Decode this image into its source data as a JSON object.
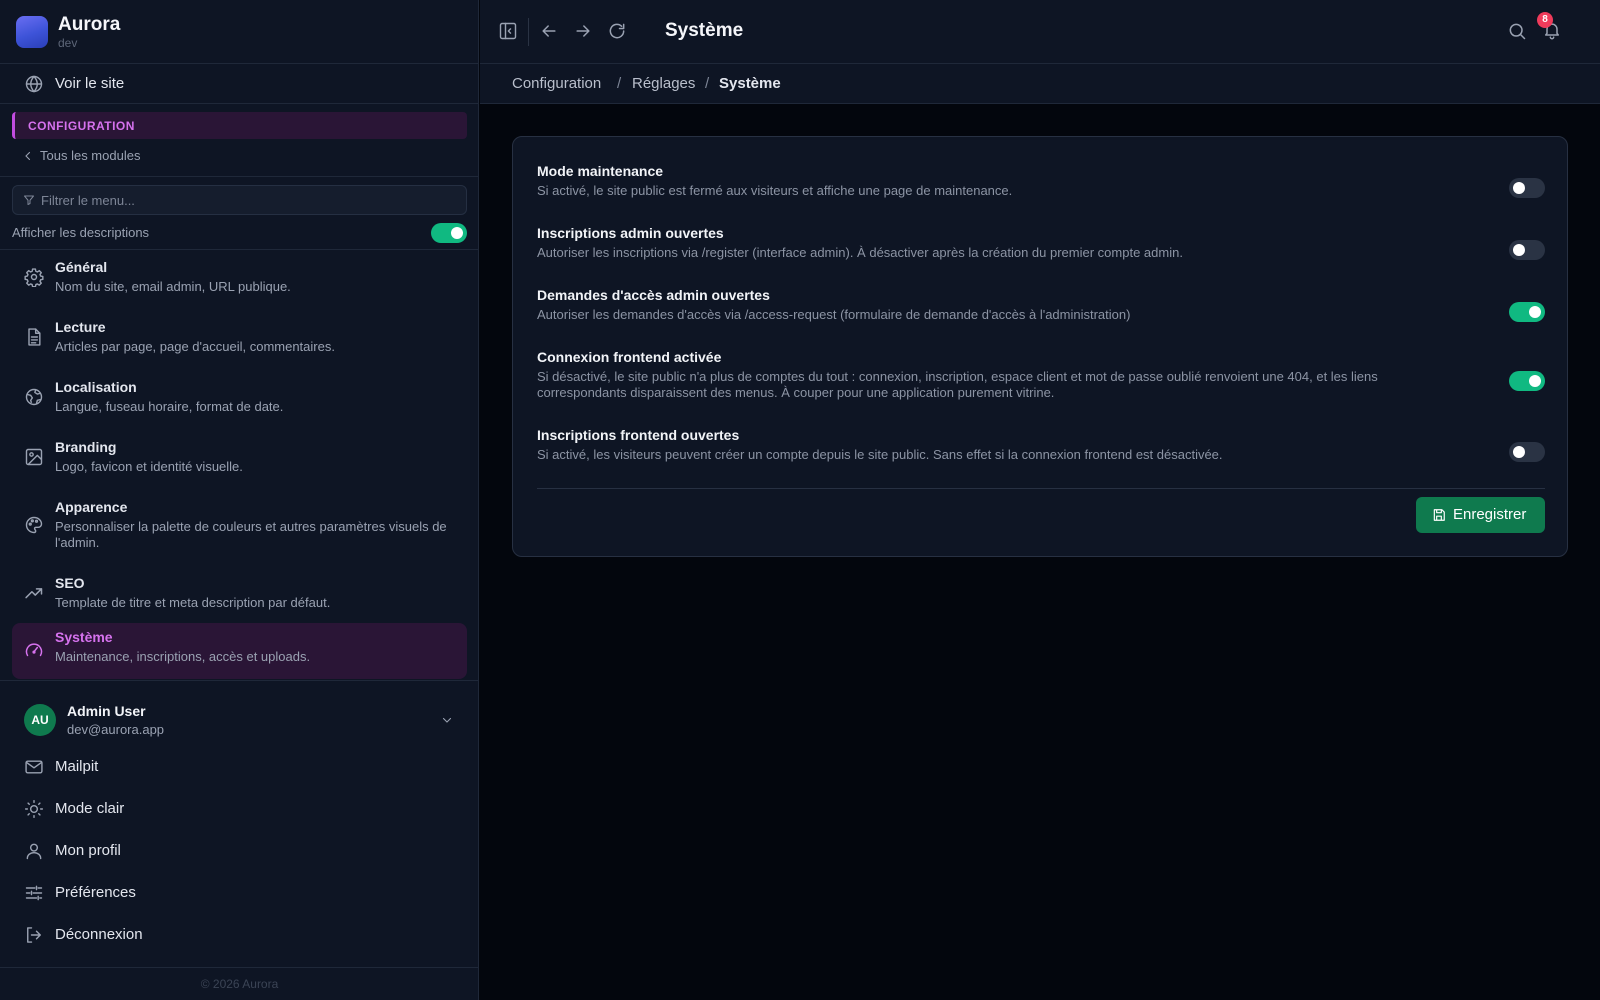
{
  "app": {
    "name": "Aurora",
    "env": "dev"
  },
  "colors": {
    "accent": "#d672ee",
    "active_bg": "#2a1536",
    "toggle_on": "#10b981",
    "primary_button": "#0f7a4e",
    "badge": "#ef3b5b"
  },
  "sidebar": {
    "view_site": {
      "label": "Voir le site",
      "icon": "globe-icon"
    },
    "section_label": "CONFIGURATION",
    "back_label": "Tous les modules",
    "filter": {
      "placeholder": "Filtrer le menu...",
      "value": ""
    },
    "show_descriptions": {
      "label": "Afficher les descriptions",
      "enabled": true
    },
    "items": [
      {
        "title": "Général",
        "desc": "Nom du site, email admin, URL publique.",
        "icon": "gear-icon",
        "active": false
      },
      {
        "title": "Lecture",
        "desc": "Articles par page, page d'accueil, commentaires.",
        "icon": "document-icon",
        "active": false
      },
      {
        "title": "Localisation",
        "desc": "Langue, fuseau horaire, format de date.",
        "icon": "earth-icon",
        "active": false
      },
      {
        "title": "Branding",
        "desc": "Logo, favicon et identité visuelle.",
        "icon": "image-icon",
        "active": false
      },
      {
        "title": "Apparence",
        "desc": "Personnaliser la palette de couleurs et autres paramètres visuels de l'admin.",
        "icon": "palette-icon",
        "active": false
      },
      {
        "title": "SEO",
        "desc": "Template de titre et meta description par défaut.",
        "icon": "trending-up-icon",
        "active": false
      },
      {
        "title": "Système",
        "desc": "Maintenance, inscriptions, accès et uploads.",
        "icon": "gauge-icon",
        "active": true
      }
    ],
    "user": {
      "initials": "AU",
      "name": "Admin User",
      "email": "dev@aurora.app"
    },
    "bottom_items": [
      {
        "label": "Mailpit",
        "icon": "mail-icon"
      },
      {
        "label": "Mode clair",
        "icon": "sun-icon"
      },
      {
        "label": "Mon profil",
        "icon": "user-icon"
      },
      {
        "label": "Préférences",
        "icon": "sliders-icon"
      },
      {
        "label": "Déconnexion",
        "icon": "logout-icon"
      }
    ],
    "copyright": "© 2026 Aurora"
  },
  "topbar": {
    "title": "Système",
    "notifications_count": "8"
  },
  "breadcrumb": [
    "Configuration",
    "Réglages",
    "Système"
  ],
  "settings": [
    {
      "title": "Mode maintenance",
      "desc": "Si activé, le site public est fermé aux visiteurs et affiche une page de maintenance.",
      "enabled": false
    },
    {
      "title": "Inscriptions admin ouvertes",
      "desc": "Autoriser les inscriptions via /register (interface admin). À désactiver après la création du premier compte admin.",
      "enabled": false
    },
    {
      "title": "Demandes d'accès admin ouvertes",
      "desc": "Autoriser les demandes d'accès via /access-request (formulaire de demande d'accès à l'administration)",
      "enabled": true
    },
    {
      "title": "Connexion frontend activée",
      "desc": "Si désactivé, le site public n'a plus de comptes du tout : connexion, inscription, espace client et mot de passe oublié renvoient une 404, et les liens correspondants disparaissent des menus. À couper pour une application purement vitrine.",
      "enabled": true
    },
    {
      "title": "Inscriptions frontend ouvertes",
      "desc": "Si activé, les visiteurs peuvent créer un compte depuis le site public. Sans effet si la connexion frontend est désactivée.",
      "enabled": false
    }
  ],
  "save_label": "Enregistrer"
}
